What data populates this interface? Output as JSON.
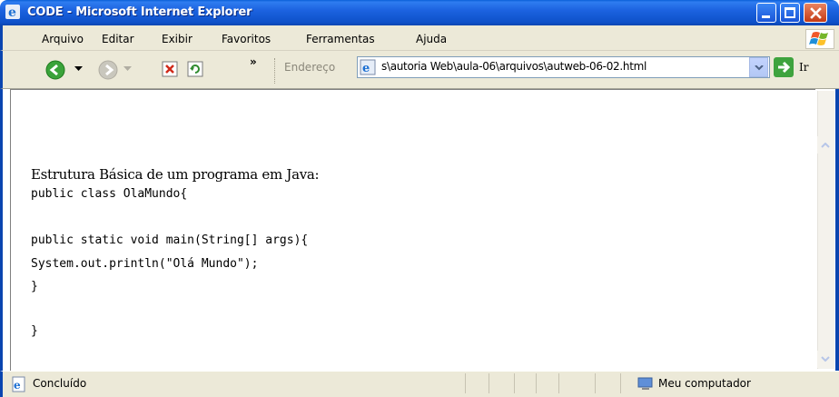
{
  "window": {
    "title": "CODE - Microsoft Internet Explorer"
  },
  "menu": {
    "items": [
      {
        "label": "Arquivo"
      },
      {
        "label": "Editar"
      },
      {
        "label": "Exibir"
      },
      {
        "label": "Favoritos"
      },
      {
        "label": "Ferramentas"
      },
      {
        "label": "Ajuda"
      }
    ]
  },
  "toolbar": {
    "chevron": "»",
    "address_label": "Endereço",
    "address_value": "s\\autoria Web\\aula-06\\arquivos\\autweb-06-02.html",
    "go_label": "Ir"
  },
  "page": {
    "heading": "Estrutura Básica de um programa em Java:",
    "code_lines": [
      "public class OlaMundo{",
      "public static void main(String[] args){",
      "System.out.println(\"Olá Mundo\");",
      "}",
      "}"
    ]
  },
  "status": {
    "text": "Concluído",
    "zone": "Meu computador"
  },
  "colors": {
    "titlebar": "#0e51c9",
    "chrome": "#ece9d8",
    "address_border": "#7f9db9"
  }
}
